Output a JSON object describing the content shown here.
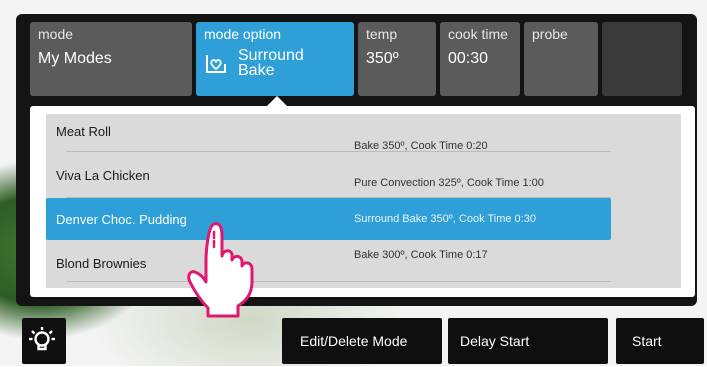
{
  "tabs": {
    "mode": {
      "caption": "mode",
      "value": "My Modes"
    },
    "mode_option": {
      "caption": "mode option",
      "line1": "Surround",
      "line2": "Bake",
      "icon": "heart-dish-icon"
    },
    "temp": {
      "caption": "temp",
      "value": "350º"
    },
    "cook_time": {
      "caption": "cook time",
      "value": "00:30"
    },
    "probe": {
      "caption": "probe",
      "value": ""
    }
  },
  "modes": [
    {
      "name": "Meat Roll",
      "detail": "Bake 350º, Cook Time  0:20",
      "selected": false
    },
    {
      "name": "Viva La Chicken",
      "detail": "Pure Convection 325º, Cook Time  1:00",
      "selected": false
    },
    {
      "name": "Denver  Choc. Pudding",
      "detail": "Surround Bake 350º, Cook Time  0:30",
      "selected": true
    },
    {
      "name": "Blond Brownies",
      "detail": "Bake 300º, Cook Time  0:17",
      "selected": false
    }
  ],
  "buttons": {
    "light_icon": "light-bulb-icon",
    "edit": "Edit/Delete Mode",
    "delay": "Delay Start",
    "start": "Start"
  },
  "colors": {
    "accent": "#2f9fd8",
    "tab": "#5b5b5b",
    "bezel": "#141414",
    "finger": "#e0166f"
  }
}
